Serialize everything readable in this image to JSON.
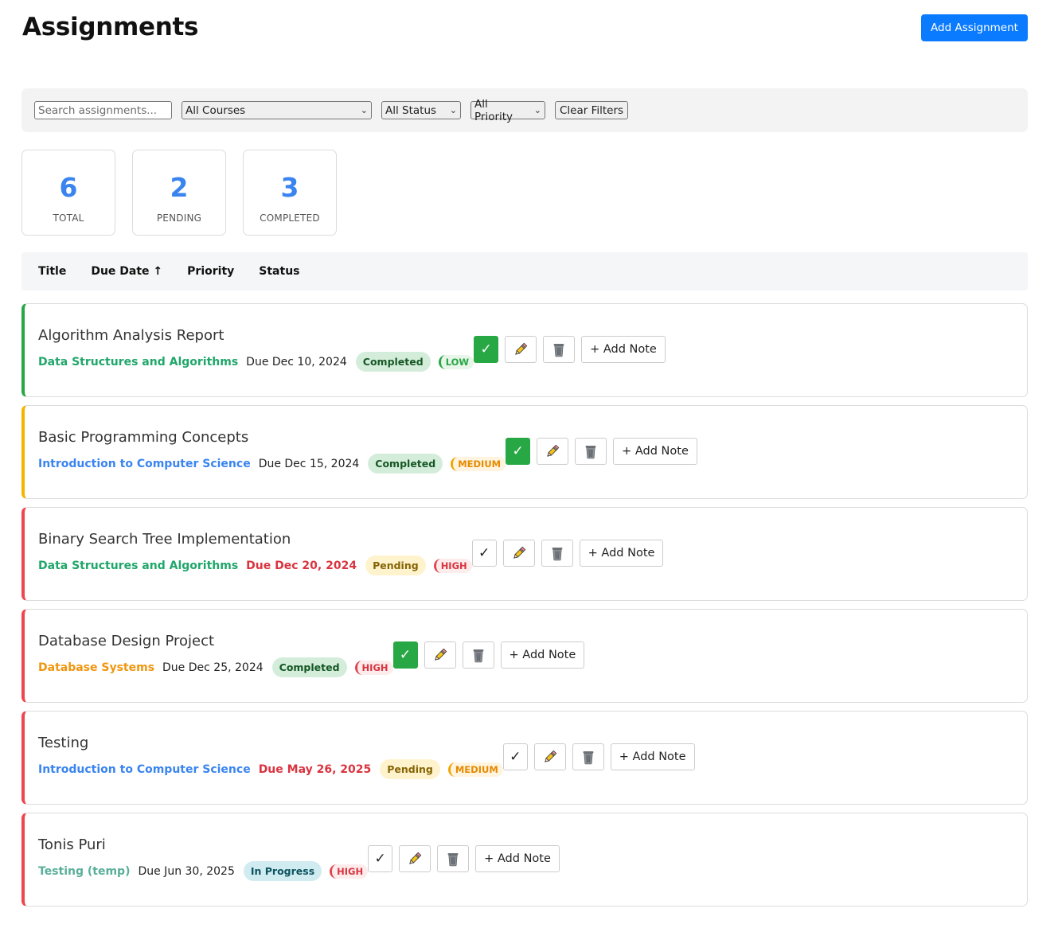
{
  "header": {
    "title": "Assignments",
    "add_button": "Add Assignment"
  },
  "filters": {
    "search_placeholder": "Search assignments...",
    "course_select": "All Courses",
    "status_select": "All Status",
    "priority_select": "All Priority",
    "clear_button": "Clear Filters"
  },
  "stats": [
    {
      "value": "6",
      "label": "TOTAL"
    },
    {
      "value": "2",
      "label": "PENDING"
    },
    {
      "value": "3",
      "label": "COMPLETED"
    }
  ],
  "sort": {
    "title": "Title",
    "due_date": "Due Date ↑",
    "priority": "Priority",
    "status": "Status"
  },
  "assignments": [
    {
      "title": "Algorithm Analysis Report",
      "course": "Data Structures and Algorithms",
      "course_color": "#20a66a",
      "due": "Due Dec 10, 2024",
      "overdue": false,
      "status": "Completed",
      "status_kind": "completed",
      "priority": "LOW",
      "priority_kind": "low",
      "border_color": "#28a745",
      "done": true,
      "note_label": "+ Add Note"
    },
    {
      "title": "Basic Programming Concepts",
      "course": "Introduction to Computer Science",
      "course_color": "#3a84f0",
      "due": "Due Dec 15, 2024",
      "overdue": false,
      "status": "Completed",
      "status_kind": "completed",
      "priority": "MEDIUM",
      "priority_kind": "medium",
      "border_color": "#f5b400",
      "done": true,
      "note_label": "+ Add Note"
    },
    {
      "title": "Binary Search Tree Implementation",
      "course": "Data Structures and Algorithms",
      "course_color": "#20a66a",
      "due": "Due Dec 20, 2024",
      "overdue": true,
      "status": "Pending",
      "status_kind": "pending",
      "priority": "HIGH",
      "priority_kind": "high",
      "border_color": "#f0454f",
      "done": false,
      "note_label": "+ Add Note"
    },
    {
      "title": "Database Design Project",
      "course": "Database Systems",
      "course_color": "#f0960e",
      "due": "Due Dec 25, 2024",
      "overdue": false,
      "status": "Completed",
      "status_kind": "completed",
      "priority": "HIGH",
      "priority_kind": "high",
      "border_color": "#f0454f",
      "done": true,
      "note_label": "+ Add Note"
    },
    {
      "title": "Testing",
      "course": "Introduction to Computer Science",
      "course_color": "#3a84f0",
      "due": "Due May 26, 2025",
      "overdue": true,
      "status": "Pending",
      "status_kind": "pending",
      "priority": "MEDIUM",
      "priority_kind": "medium",
      "border_color": "#f0454f",
      "done": false,
      "note_label": "+ Add Note"
    },
    {
      "title": "Tonis Puri",
      "course": "Testing (temp)",
      "course_color": "#5aaf9a",
      "due": "Due Jun 30, 2025",
      "overdue": false,
      "status": "In Progress",
      "status_kind": "progress",
      "priority": "HIGH",
      "priority_kind": "high",
      "border_color": "#f0454f",
      "done": false,
      "note_label": "+ Add Note"
    }
  ],
  "icons": {
    "complete": "checkmark-icon",
    "edit": "pencil-icon",
    "delete": "trash-icon"
  }
}
